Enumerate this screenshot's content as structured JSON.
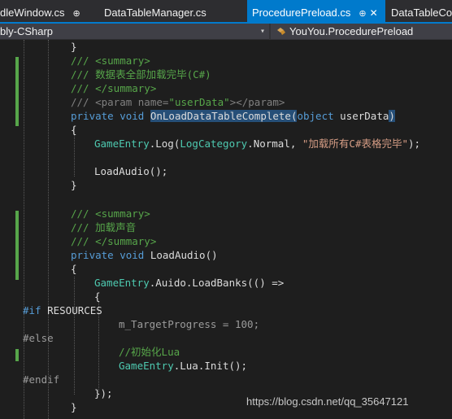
{
  "tabs": [
    {
      "label": "dleWindow.cs",
      "pin": "⊕",
      "active": false
    },
    {
      "label": "DataTableManager.cs",
      "active": false
    },
    {
      "label": "ProcedurePreload.cs",
      "pin": "⊕",
      "close": "✕",
      "active": true
    },
    {
      "label": "DataTableCo",
      "active": false
    }
  ],
  "nav": {
    "project": "bly-CSharp",
    "member": "YouYou.ProcedurePreload",
    "dropdown_glyph": "▾"
  },
  "code": {
    "brace_close_1": "}",
    "summary_open_1": "/// <summary>",
    "summary_text_1": "/// 数据表全部加载完毕(C#)",
    "summary_close_1": "/// </summary>",
    "param_prefix": "/// <param name=",
    "param_name": "\"userData\"",
    "param_suffix": "></param>",
    "m1_private": "private",
    "m1_void": "void",
    "m1_name": "OnLoadDataTableComplete",
    "m1_paren_open": "(",
    "m1_object": "object",
    "m1_param": " userData",
    "m1_paren_close": ")",
    "brace_open_2": "{",
    "log_entry": "GameEntry",
    "log_call": ".Log(",
    "log_cat": "LogCategory",
    "log_normal": ".Normal, ",
    "log_str": "\"加载所有C#表格完毕\"",
    "log_end": ");",
    "load_audio_call": "LoadAudio();",
    "brace_close_2": "}",
    "summary_open_2": "/// <summary>",
    "summary_text_2": "/// 加载声音",
    "summary_close_2": "/// </summary>",
    "m2_private": "private",
    "m2_void": "void",
    "m2_name": " LoadAudio()",
    "brace_open_3": "{",
    "auido_entry": "GameEntry",
    "auido_call": ".Auido.LoadBanks(() =>",
    "brace_open_4": "{",
    "if_directive": "#if",
    "if_symbol": " RESOURCES",
    "progress_line": "m_TargetProgress = 100;",
    "else_directive": "#else",
    "init_comment": "//初始化Lua",
    "lua_entry": "GameEntry",
    "lua_call": ".Lua.Init();",
    "endif_directive": "#endif",
    "close_lambda": "});",
    "brace_close_3": "}"
  },
  "watermark": "https://blog.csdn.net/qq_35647121",
  "colors": {
    "background": "#1e1e1e",
    "tab_active": "#007acc",
    "keyword": "#569cd6",
    "comment": "#57a64a",
    "type": "#4ec9b0",
    "string": "#d69d85"
  }
}
